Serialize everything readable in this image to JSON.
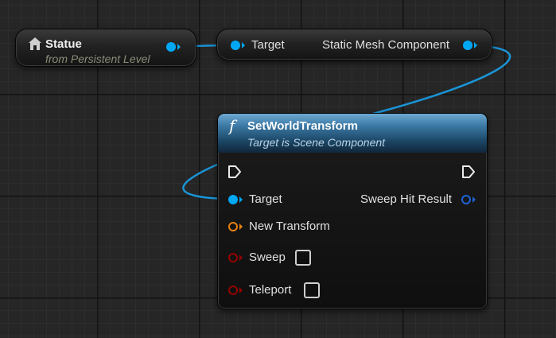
{
  "nodes": {
    "statue": {
      "title": "Statue",
      "subtitle": "from Persistent Level",
      "icon": "actor-reference-icon"
    },
    "target_getter": {
      "input_label": "Target",
      "output_label": "Static Mesh Component"
    },
    "set_world_transform": {
      "icon_glyph": "f",
      "title": "SetWorldTransform",
      "subtitle": "Target is Scene Component",
      "inputs": {
        "target": "Target",
        "new_transform": "New Transform",
        "sweep": "Sweep",
        "teleport": "Teleport"
      },
      "outputs": {
        "sweep_hit_result": "Sweep Hit Result"
      },
      "sweep_checked": false,
      "teleport_checked": false
    }
  },
  "colors": {
    "object_pin": "#00a8f4",
    "struct_pin": "#1d63d6",
    "transform_pin": "#e9820f",
    "bool_pin": "#940000",
    "header": "#3d7aa6"
  }
}
